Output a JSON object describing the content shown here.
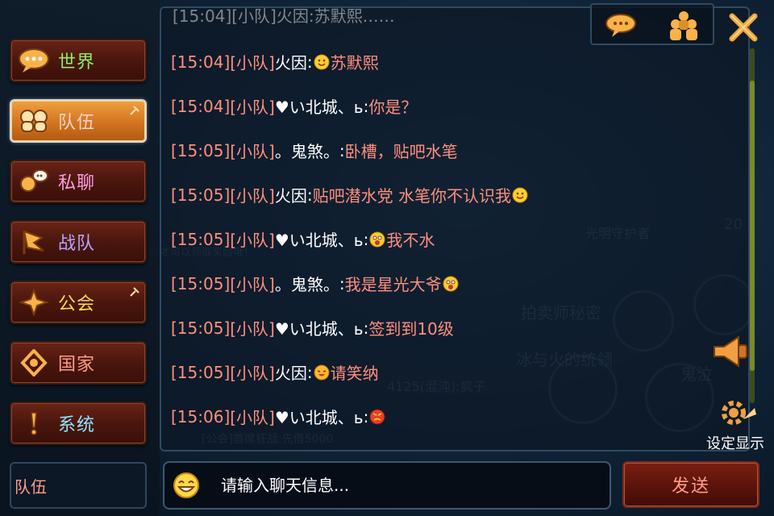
{
  "sidebar": {
    "channels": [
      {
        "label": "世界",
        "color": "#8af06a",
        "icon": "speech-bubble-icon"
      },
      {
        "label": "队伍",
        "color": "#ffd3c8",
        "icon": "team-icon",
        "active": true
      },
      {
        "label": "私聊",
        "color": "#ff9ee0",
        "icon": "whisper-icon"
      },
      {
        "label": "战队",
        "color": "#b3a7ff",
        "icon": "flag-icon"
      },
      {
        "label": "公会",
        "color": "#ffd84a",
        "icon": "guild-icon"
      },
      {
        "label": "国家",
        "color": "#ff9d86",
        "icon": "nation-icon"
      },
      {
        "label": "系统",
        "color": "#8ce6ff",
        "icon": "exclamation-icon"
      }
    ],
    "current_channel": "队伍"
  },
  "chat": {
    "top_partial": "[15:04][小队]火因:苏默熙……",
    "messages": [
      {
        "time": "[15:04]",
        "tag": "[小队]",
        "sender": "火因",
        "text_before": "",
        "emoji": "smile-emoji",
        "text": "苏默熙"
      },
      {
        "time": "[15:04]",
        "tag": "[小队]",
        "sender": "♥い北城、ь",
        "text_before": "你是？",
        "emoji": "",
        "text": ""
      },
      {
        "time": "[15:05]",
        "tag": "[小队]",
        "sender": "。鬼煞。",
        "text_before": "卧槽，贴吧水笔",
        "emoji": "",
        "text": ""
      },
      {
        "time": "[15:05]",
        "tag": "[小队]",
        "sender": "火因",
        "text_before": "贴吧潜水党 水笔你不认识我",
        "emoji": "smile-emoji",
        "text": ""
      },
      {
        "time": "[15:05]",
        "tag": "[小队]",
        "sender": "♥い北城、ь",
        "text_before": "",
        "emoji": "shocked-emoji",
        "text": "我不水"
      },
      {
        "time": "[15:05]",
        "tag": "[小队]",
        "sender": "。鬼煞。",
        "text_before": "我是星光大爷",
        "emoji": "shocked-emoji",
        "text": ""
      },
      {
        "time": "[15:05]",
        "tag": "[小队]",
        "sender": "♥い北城、ь",
        "text_before": "签到到10级",
        "emoji": "",
        "text": ""
      },
      {
        "time": "[15:05]",
        "tag": "[小队]",
        "sender": "火因",
        "text_before": "",
        "emoji": "laugh-emoji",
        "text": " 请笑纳"
      },
      {
        "time": "[15:06]",
        "tag": "[小队]",
        "sender": "♥い北城、ь",
        "text_before": "",
        "emoji": "angry-emoji",
        "text": ""
      }
    ]
  },
  "input": {
    "placeholder": "请输入聊天信息...",
    "value": ""
  },
  "buttons": {
    "send": "发送",
    "settings": "设定显示"
  },
  "background_text": [
    "光明守护者",
    "冰与火的统领",
    "鬼泣",
    "有才可以领取奖励哦！",
    "4125(混沌):疯子",
    "[公会]首席狂战:先借5000",
    "拍卖师秘密",
    "20"
  ]
}
